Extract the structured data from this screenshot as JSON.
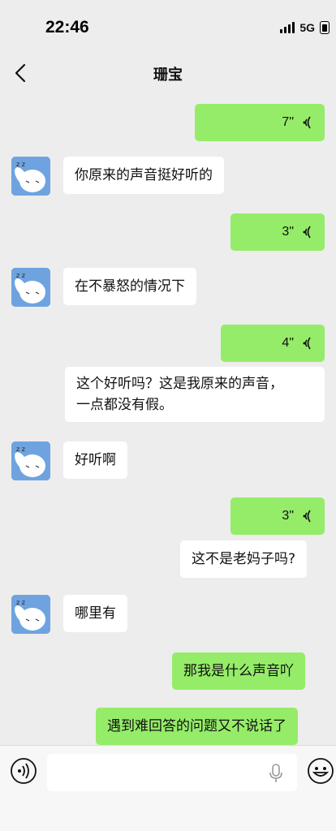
{
  "status_bar": {
    "time": "22:46",
    "network": "5G"
  },
  "header": {
    "title": "珊宝"
  },
  "messages": [
    {
      "side": "out",
      "kind": "voice",
      "duration": "7\""
    },
    {
      "side": "in",
      "kind": "text",
      "text": "你原来的声音挺好听的"
    },
    {
      "side": "out",
      "kind": "voice",
      "duration": "3\""
    },
    {
      "side": "in",
      "kind": "text",
      "text": "在不暴怒的情况下"
    },
    {
      "side": "out",
      "kind": "voice",
      "duration": "4\""
    },
    {
      "side": "out",
      "kind": "text",
      "lines": [
        "这个好听吗？这是我原来的声音，",
        "一点都没有假。"
      ]
    },
    {
      "side": "in",
      "kind": "text",
      "text": "好听啊"
    },
    {
      "side": "out",
      "kind": "voice",
      "duration": "3\""
    },
    {
      "side": "out",
      "kind": "text",
      "text": "这不是老妈子吗?"
    },
    {
      "side": "in",
      "kind": "text",
      "text": "哪里有"
    },
    {
      "side": "out",
      "kind": "text",
      "text": "那我是什么声音吖"
    },
    {
      "side": "out",
      "kind": "text",
      "text": "遇到难回答的问题又不说话了"
    }
  ],
  "colors": {
    "outgoing": "#95ec69",
    "incoming": "#ffffff",
    "background": "#ededed"
  },
  "input_bar": {
    "placeholder": ""
  }
}
